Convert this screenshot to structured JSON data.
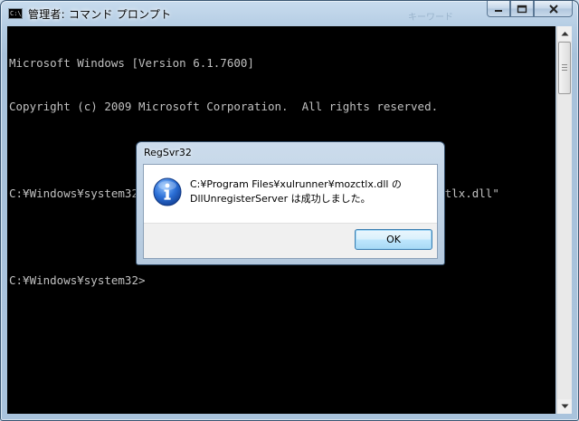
{
  "window": {
    "title": "管理者: コマンド プロンプト",
    "background_hint": "キーワード",
    "app_icon_text": "C:\\_"
  },
  "console": {
    "lines": [
      "Microsoft Windows [Version 6.1.7600]",
      "Copyright (c) 2009 Microsoft Corporation.  All rights reserved.",
      "",
      "C:¥Windows¥system32>regsvr32 /u \"C:¥Program Files¥xulrunner¥mozctlx.dll\"",
      "",
      "C:¥Windows¥system32>"
    ]
  },
  "dialog": {
    "title": "RegSvr32",
    "message_line1": "C:¥Program Files¥xulrunner¥mozctlx.dll の",
    "message_line2": "DllUnregisterServer は成功しました。",
    "ok_label": "OK",
    "icon": "information-icon"
  },
  "colors": {
    "console_bg": "#000000",
    "console_fg": "#c0c0c0",
    "info_icon": "#1f5fbf"
  }
}
